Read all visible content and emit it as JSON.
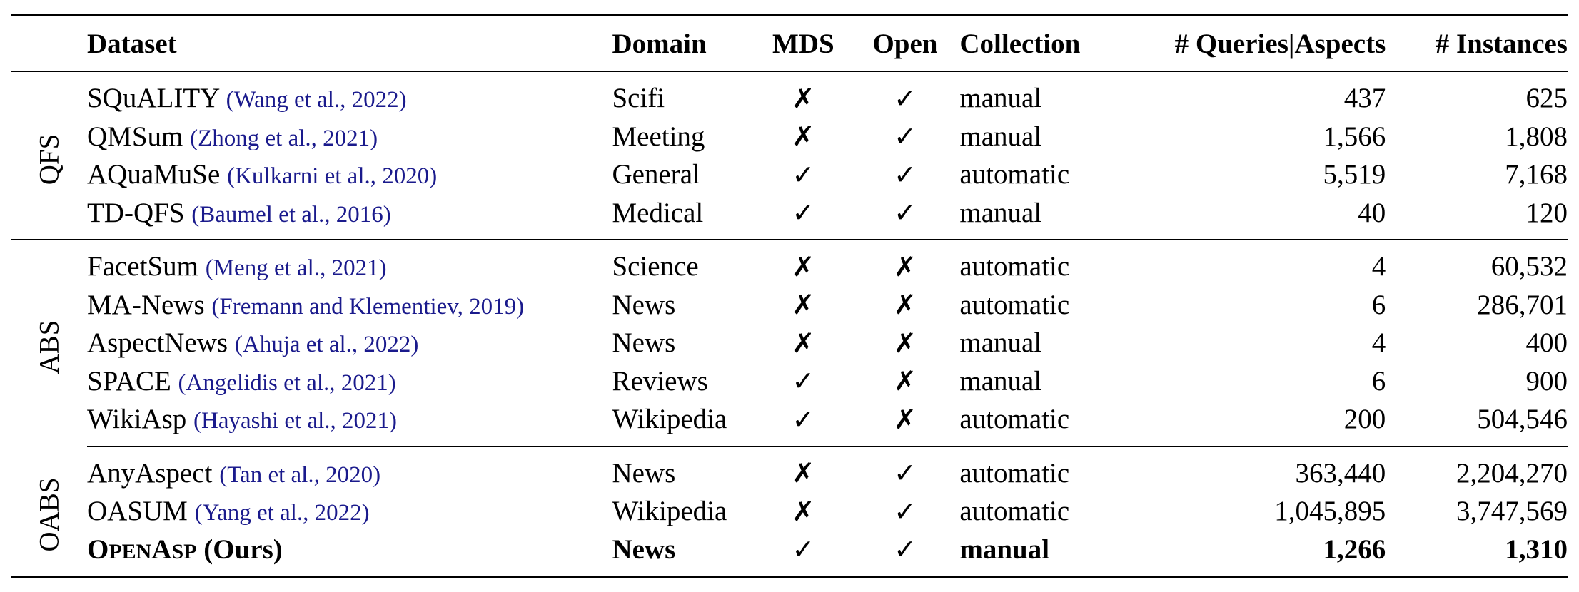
{
  "headers": {
    "dataset": "Dataset",
    "domain": "Domain",
    "mds": "MDS",
    "open": "Open",
    "collection": "Collection",
    "queries": "# Queries|Aspects",
    "instances": "# Instances"
  },
  "groups": [
    {
      "label": "QFS",
      "rows": [
        {
          "name": "SQuALITY",
          "cite": "Wang et al., 2022",
          "domain": "Scifi",
          "mds": "✗",
          "open": "✓",
          "collection": "manual",
          "queries": "437",
          "instances": "625"
        },
        {
          "name": "QMSum",
          "cite": "Zhong et al., 2021",
          "domain": "Meeting",
          "mds": "✗",
          "open": "✓",
          "collection": "manual",
          "queries": "1,566",
          "instances": "1,808"
        },
        {
          "name": "AQuaMuSe",
          "cite": "Kulkarni et al., 2020",
          "domain": "General",
          "mds": "✓",
          "open": "✓",
          "collection": "automatic",
          "queries": "5,519",
          "instances": "7,168"
        },
        {
          "name": "TD-QFS",
          "cite": "Baumel et al., 2016",
          "domain": "Medical",
          "mds": "✓",
          "open": "✓",
          "collection": "manual",
          "queries": "40",
          "instances": "120"
        }
      ]
    },
    {
      "label": "ABS",
      "rows": [
        {
          "name": "FacetSum",
          "cite": "Meng et al., 2021",
          "domain": "Science",
          "mds": "✗",
          "open": "✗",
          "collection": "automatic",
          "queries": "4",
          "instances": "60,532"
        },
        {
          "name": "MA-News",
          "cite": "Fremann and Klementiev, 2019",
          "domain": "News",
          "mds": "✗",
          "open": "✗",
          "collection": "automatic",
          "queries": "6",
          "instances": "286,701"
        },
        {
          "name": "AspectNews",
          "cite": "Ahuja et al., 2022",
          "domain": "News",
          "mds": "✗",
          "open": "✗",
          "collection": "manual",
          "queries": "4",
          "instances": "400"
        },
        {
          "name": "SPACE",
          "cite": "Angelidis et al., 2021",
          "domain": "Reviews",
          "mds": "✓",
          "open": "✗",
          "collection": "manual",
          "queries": "6",
          "instances": "900"
        },
        {
          "name": "WikiAsp",
          "cite": "Hayashi et al., 2021",
          "domain": "Wikipedia",
          "mds": "✓",
          "open": "✗",
          "collection": "automatic",
          "queries": "200",
          "instances": "504,546"
        }
      ]
    },
    {
      "label": "OABS",
      "rows": [
        {
          "name": "AnyAspect",
          "cite": "Tan et al., 2020",
          "domain": "News",
          "mds": "✗",
          "open": "✓",
          "collection": "automatic",
          "queries": "363,440",
          "instances": "2,204,270"
        },
        {
          "name": "OASUM",
          "cite": "Yang et al., 2022",
          "domain": "Wikipedia",
          "mds": "✗",
          "open": "✓",
          "collection": "automatic",
          "queries": "1,045,895",
          "instances": "3,747,569"
        }
      ]
    }
  ],
  "ours": {
    "name_big_1": "O",
    "name_small_1": "PEN",
    "name_big_2": "A",
    "name_small_2": "SP",
    "suffix": " (Ours)",
    "domain": "News",
    "mds": "✓",
    "open": "✓",
    "collection": "manual",
    "queries": "1,266",
    "instances": "1,310"
  }
}
